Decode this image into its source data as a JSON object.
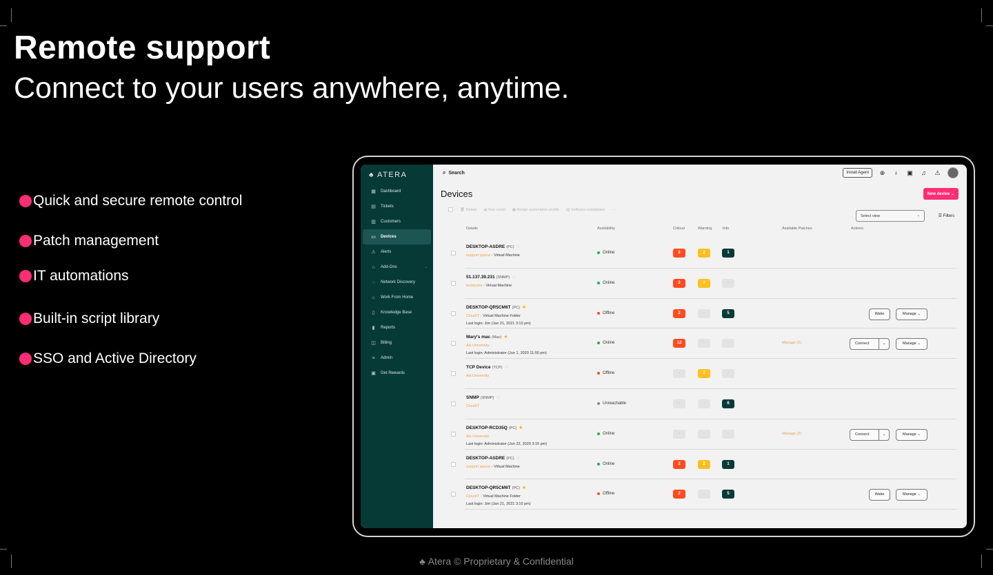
{
  "headline": "Remote support",
  "subheadline": "Connect to your users anywhere, anytime.",
  "features": [
    {
      "label": "Quick and secure remote control"
    },
    {
      "label": "Patch management"
    },
    {
      "label": "IT automations"
    },
    {
      "label": "Built-in script library"
    },
    {
      "label": "SSO and Active Directory"
    }
  ],
  "footer": "Atera © Proprietary & Confidential",
  "accent_color": "#ff2d73",
  "app": {
    "brand": "ATERA",
    "search_label": "Search",
    "install_agent": "Install Agent",
    "page_title": "Devices",
    "new_device": "New device",
    "sidebar": [
      {
        "label": "Dashboard",
        "icon": "dashboard-icon"
      },
      {
        "label": "Tickets",
        "icon": "ticket-icon"
      },
      {
        "label": "Customers",
        "icon": "customers-icon"
      },
      {
        "label": "Devices",
        "icon": "devices-icon",
        "active": true
      },
      {
        "label": "Alerts",
        "icon": "alert-icon"
      },
      {
        "label": "Add-Ons",
        "icon": "addons-icon"
      },
      {
        "label": "Network Discovery",
        "icon": "network-icon"
      },
      {
        "label": "Work From Home",
        "icon": "home-icon"
      },
      {
        "label": "Knowledge Base",
        "icon": "book-icon"
      },
      {
        "label": "Reports",
        "icon": "reports-icon"
      },
      {
        "label": "Billing",
        "icon": "billing-icon"
      },
      {
        "label": "Admin",
        "icon": "admin-icon"
      },
      {
        "label": "Get Rewards",
        "icon": "gift-icon"
      }
    ],
    "toolbar": {
      "delete": "Delete",
      "run_script": "Run script",
      "assign_profile": "Assign automation profile",
      "software_installation": "Software installation",
      "more": "···"
    },
    "select_view": "Select view",
    "filters": "Filters",
    "columns": {
      "details": "Details",
      "availability": "Availability",
      "critical": "Critical",
      "warning": "Warning",
      "info": "Info",
      "patches": "Available Patches",
      "actions": "Actions"
    },
    "devices": [
      {
        "name": "DESKTOP-ASDRE",
        "type": "(PC)",
        "starred": false,
        "org": "support queue",
        "sub": "· Virtual Machine",
        "login": "",
        "status": "Online",
        "status_color": "#22b14c",
        "critical": "2",
        "warning": "2",
        "info": "1",
        "patches": "",
        "wake": false,
        "connect": false,
        "manage": false
      },
      {
        "name": "51.137.39.231",
        "type": "(SNMP)",
        "starred": false,
        "org": "techpulse",
        "sub": "· Virtual Machine",
        "login": "",
        "status": "Online",
        "status_color": "#22b14c",
        "critical": "2",
        "warning": "2",
        "info": "-",
        "patches": "",
        "wake": false,
        "connect": false,
        "manage": false
      },
      {
        "name": "DESKTOP-QR5CM6T",
        "type": "(PC)",
        "starred": true,
        "org": "CloudIT",
        "sub": "· Virtual Machine Folder",
        "login": "Last login: Jim (Jan 21, 2021 3:10 pm)",
        "status": "Offline",
        "status_color": "#ff4b1f",
        "critical": "2",
        "warning": "-",
        "info": "5",
        "patches": "",
        "wake": true,
        "connect": false,
        "manage": true
      },
      {
        "name": "Mary's mac",
        "type": "(Mac)",
        "starred": true,
        "org": "Aix University",
        "sub": "",
        "login": "Last login: Administrator (Jun 1, 2020 11:00 pm)",
        "status": "Online",
        "status_color": "#22b14c",
        "critical": "12",
        "warning": "-",
        "info": "-",
        "patches": "Manage (2)",
        "wake": false,
        "connect": true,
        "manage": true
      },
      {
        "name": "TCP Device",
        "type": "(TCP)",
        "starred": false,
        "org": "Aix University",
        "sub": "",
        "login": "",
        "status": "Offline",
        "status_color": "#ff4b1f",
        "critical": "-",
        "warning": "2",
        "info": "-",
        "patches": "",
        "wake": false,
        "connect": false,
        "manage": false
      },
      {
        "name": "SNMP",
        "type": "(SNMP)",
        "starred": false,
        "org": "CloudIT",
        "sub": "",
        "login": "",
        "status": "Unreachable",
        "status_color": "#888888",
        "critical": "-",
        "warning": "-",
        "info": "6",
        "patches": "",
        "wake": false,
        "connect": false,
        "manage": false
      },
      {
        "name": "DESKTOP-RCD35Q",
        "type": "(PC)",
        "starred": true,
        "org": "Aix University",
        "sub": "",
        "login": "Last login: Administrator (Jun 22, 2020 3:15 pm)",
        "status": "Online",
        "status_color": "#22b14c",
        "critical": "-",
        "warning": "-",
        "info": "-",
        "patches": "Manage (2)",
        "wake": false,
        "connect": true,
        "manage": true
      },
      {
        "name": "DESKTOP-ASDRE",
        "type": "(PC)",
        "starred": false,
        "org": "support queue",
        "sub": "· Virtual Machine",
        "login": "",
        "status": "Online",
        "status_color": "#22b14c",
        "critical": "2",
        "warning": "2",
        "info": "1",
        "patches": "",
        "wake": false,
        "connect": false,
        "manage": false
      },
      {
        "name": "DESKTOP-QR5CM6T",
        "type": "(PC)",
        "starred": true,
        "org": "CloudIT",
        "sub": "· Virtual Machine Folder",
        "login": "Last login: Jim (Jan 21, 2021 3:10 pm)",
        "status": "Offline",
        "status_color": "#ff4b1f",
        "critical": "2",
        "warning": "-",
        "info": "5",
        "patches": "",
        "wake": true,
        "connect": false,
        "manage": true
      }
    ],
    "actions": {
      "wake": "Wake",
      "manage": "Manage",
      "connect": "Connect"
    }
  }
}
